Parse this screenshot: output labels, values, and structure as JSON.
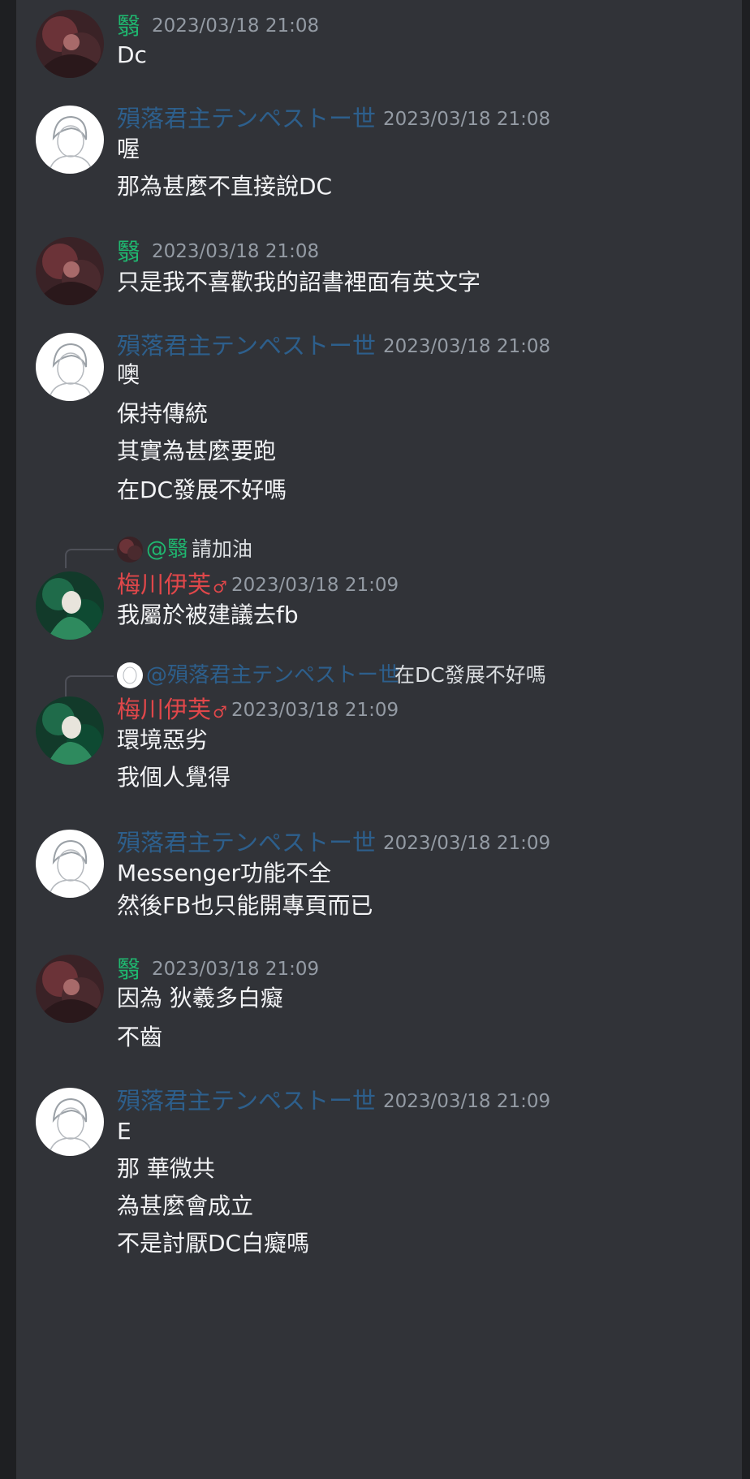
{
  "users": {
    "yi": {
      "name": "翳",
      "name_color": "#1fb870"
    },
    "tempest": {
      "name": "殞落君主テンペストー世",
      "name_color": "#2d5f8c"
    },
    "meichuan": {
      "name": "梅川伊芙",
      "badge": "♂",
      "name_color": "#e0474a"
    }
  },
  "messages": [
    {
      "author": "翳",
      "timestamp": "2023/03/18 21:08",
      "lines": [
        "Dc"
      ]
    },
    {
      "author": "殞落君主テンペストー世",
      "timestamp": "2023/03/18 21:08",
      "lines": [
        "喔",
        "那為甚麼不直接說DC"
      ]
    },
    {
      "author": "翳",
      "timestamp": "2023/03/18 21:08",
      "lines": [
        "只是我不喜歡我的詔書裡面有英文字"
      ]
    },
    {
      "author": "殞落君主テンペストー世",
      "timestamp": "2023/03/18 21:08",
      "lines": [
        "噢",
        "保持傳統",
        "其實為甚麼要跑",
        "在DC發展不好嗎"
      ]
    },
    {
      "reply_to": "@翳",
      "reply_text": "請加油",
      "author": "梅川伊芙",
      "timestamp": "2023/03/18 21:09",
      "lines": [
        "我屬於被建議去fb"
      ]
    },
    {
      "reply_to": "@殞落君主テンペストー世",
      "reply_text": "在DC發展不好嗎",
      "author": "梅川伊芙",
      "timestamp": "2023/03/18 21:09",
      "lines": [
        "環境惡劣",
        "我個人覺得"
      ]
    },
    {
      "author": "殞落君主テンペストー世",
      "timestamp": "2023/03/18 21:09",
      "lines": [
        "Messenger功能不全",
        "然後FB也只能開專頁而已"
      ]
    },
    {
      "author": "翳",
      "timestamp": "2023/03/18 21:09",
      "lines": [
        "因為 狄羲多白癡",
        "不齒"
      ]
    },
    {
      "author": "殞落君主テンペストー世",
      "timestamp": "2023/03/18 21:09",
      "lines": [
        "E",
        "那 華微共",
        "為甚麼會成立",
        "不是討厭DC白癡嗎"
      ]
    }
  ],
  "colors": {
    "background": "#313338",
    "frame": "#1e1f22",
    "timestamp": "#949ba4",
    "text": "#f2f3f5"
  }
}
